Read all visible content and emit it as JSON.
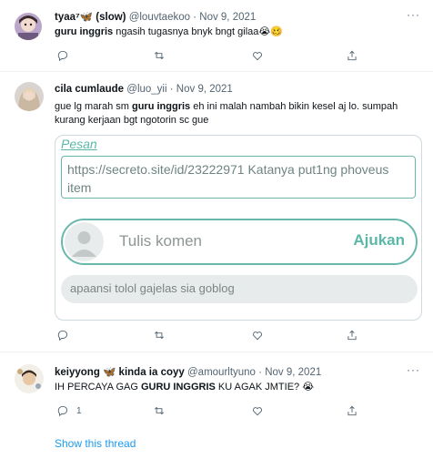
{
  "tweets": [
    {
      "name": "tyaa⁷🦋 (slow)",
      "handle": "@louvtaekoo",
      "dot": "·",
      "date": "Nov 9, 2021",
      "text_bold": "guru inggris",
      "text_rest": " ngasih tugasnya bnyk bngt gilaa😭🥴",
      "reply_count": "",
      "retweet_count": "",
      "like_count": ""
    },
    {
      "name": "cila cumlaude",
      "handle": "@luo_yii",
      "dot": "·",
      "date": "Nov 9, 2021",
      "text_pre": "gue lg marah sm ",
      "text_bold": "guru inggris",
      "text_rest": " eh ini malah nambah bikin kesel aj lo. sumpah kurang kerjaan bgt ngotorin sc gue",
      "card": {
        "title": "Pesan",
        "link_text": "https://secreto.site/id/23222971 Katanya put1ng phoveus item",
        "comment_placeholder": "Tulis komen",
        "submit_label": "Ajukan",
        "reply_text": "apaansi tolol gajelas sia goblog"
      }
    },
    {
      "name": "keiyyong 🦋 kinda ia coyy",
      "handle": "@amourltyuno",
      "dot": "·",
      "date": "Nov 9, 2021",
      "text_pre": "IH PERCAYA GAG ",
      "text_bold": "GURU INGGRIS",
      "text_rest": " KU AGAK JMTIE? 😭",
      "reply_count": "1"
    }
  ],
  "more_label": "···",
  "show_thread": "Show this thread",
  "icons": {
    "reply": "reply-icon",
    "retweet": "retweet-icon",
    "like": "heart-icon",
    "share": "share-icon",
    "more": "more-icon"
  },
  "colors": {
    "link_blue": "#1d9bf0",
    "card_accent": "#5bb8a8",
    "muted": "#536471"
  }
}
